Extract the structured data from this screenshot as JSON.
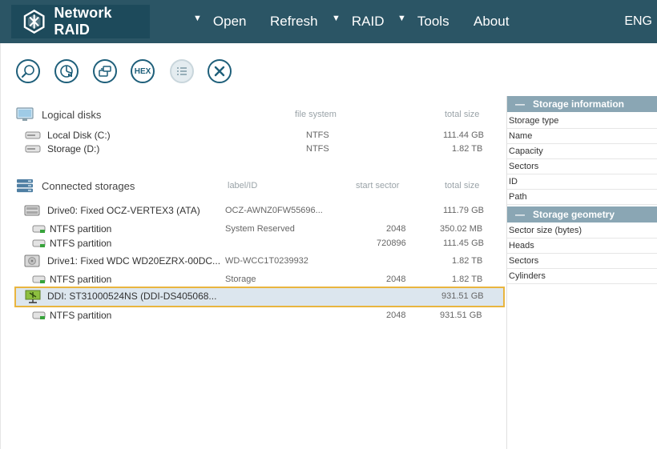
{
  "app": {
    "title": "Network RAID",
    "lang": "ENG"
  },
  "menu": [
    {
      "label": "Open",
      "caret": "▼"
    },
    {
      "label": "Refresh",
      "caret": ""
    },
    {
      "label": "RAID",
      "caret": "▼"
    },
    {
      "label": "Tools",
      "caret": "▼"
    },
    {
      "label": "About",
      "caret": ""
    }
  ],
  "toolbar": {
    "buttons": [
      {
        "name": "scan",
        "icon": "magnifier-icon"
      },
      {
        "name": "chart",
        "icon": "pie-chart-icon"
      },
      {
        "name": "image",
        "icon": "disk-image-icon"
      },
      {
        "name": "hex",
        "icon": "hex-icon",
        "label": "HEX"
      },
      {
        "name": "list",
        "icon": "list-icon",
        "disabled": true
      },
      {
        "name": "close",
        "icon": "close-icon"
      }
    ]
  },
  "logical": {
    "title": "Logical disks",
    "col_fs": "file system",
    "col_size": "total size",
    "rows": [
      {
        "name": "Local Disk (C:)",
        "fs": "NTFS",
        "size": "111.44 GB"
      },
      {
        "name": "Storage (D:)",
        "fs": "NTFS",
        "size": "1.82 TB"
      }
    ]
  },
  "connected": {
    "title": "Connected storages",
    "col_label": "label/ID",
    "col_start": "start sector",
    "col_size": "total size",
    "rows": [
      {
        "name": "Drive0: Fixed OCZ-VERTEX3 (ATA)",
        "label": "OCZ-AWNZ0FW55696...",
        "start": "",
        "size": "111.79 GB",
        "kind": "drive"
      },
      {
        "name": "NTFS partition",
        "label": "System Reserved",
        "start": "2048",
        "size": "350.02 MB",
        "kind": "partition"
      },
      {
        "name": "NTFS partition",
        "label": "",
        "start": "720896",
        "size": "111.45 GB",
        "kind": "partition"
      },
      {
        "name": "Drive1: Fixed WDC WD20EZRX-00DC...",
        "label": "WD-WCC1T0239932",
        "start": "",
        "size": "1.82 TB",
        "kind": "drive"
      },
      {
        "name": "NTFS partition",
        "label": "Storage",
        "start": "2048",
        "size": "1.82 TB",
        "kind": "partition"
      },
      {
        "name": "DDI: ST31000524NS (DDI-DS405068...",
        "label": "",
        "start": "",
        "size": "931.51 GB",
        "kind": "ddi",
        "selected": true
      },
      {
        "name": "NTFS partition",
        "label": "",
        "start": "2048",
        "size": "931.51 GB",
        "kind": "partition"
      }
    ]
  },
  "info": {
    "storage_title": "Storage information",
    "storage_items": [
      "Storage type",
      "Name",
      "Capacity",
      "Sectors",
      "ID",
      "Path"
    ],
    "geometry_title": "Storage geometry",
    "geometry_items": [
      "Sector size (bytes)",
      "Heads",
      "Sectors",
      "Cylinders"
    ]
  },
  "colors": {
    "topbar": "#2b5565",
    "accent": "#1e5f7a",
    "selection": "#dce6ee",
    "selection_border": "#e9b53f",
    "panel_header": "#8aa6b4"
  }
}
